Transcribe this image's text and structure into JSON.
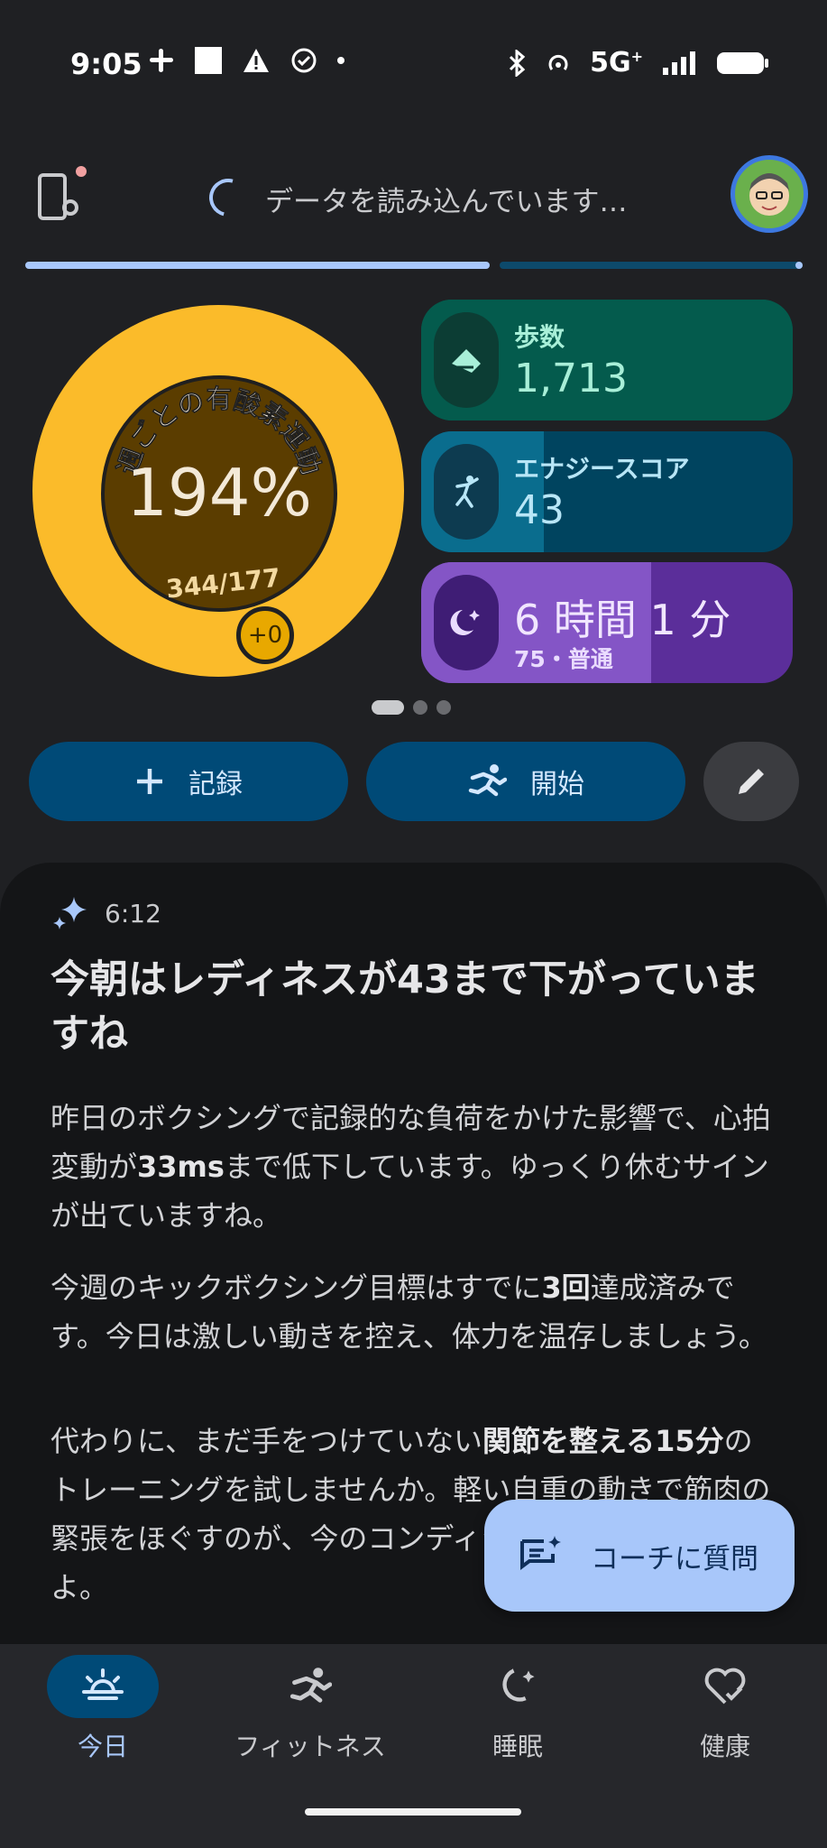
{
  "status_bar": {
    "time": "9:05",
    "network": "5G",
    "icons_left": [
      "slack-icon",
      "white-square-icon",
      "warning-icon",
      "check-circle-icon",
      "dot-icon"
    ],
    "icons_right": [
      "bluetooth-icon",
      "hotspot-icon",
      "5g-icon",
      "signal-icon",
      "battery-icon"
    ]
  },
  "header": {
    "loading_text": "データを読み込んでいます…"
  },
  "ring": {
    "label": "週ごとの有酸素運動",
    "percent": "194%",
    "ratio": "344/177",
    "badge": "+0",
    "color": "#fbbb2a"
  },
  "cards": {
    "steps": {
      "label": "歩数",
      "value": "1,713",
      "icon": "shoe-icon",
      "color": "#03584a"
    },
    "energy": {
      "label": "エナジースコア",
      "value": "43",
      "icon": "energy-person-icon",
      "fill": 0.33,
      "color": "#0a6d8e"
    },
    "sleep": {
      "value": "6 時間 1 分",
      "sub": "75・普通",
      "icon": "moon-icon",
      "fill": 0.62,
      "color": "#8455c6"
    }
  },
  "pager": {
    "count": 3,
    "active": 0
  },
  "actions": {
    "record_label": "記録",
    "start_label": "開始"
  },
  "insight": {
    "time": "6:12",
    "title": "今朝はレディネスが43まで下がっていますね",
    "p1_a": "昨日のボクシングで記録的な負荷をかけた影響で、心拍変動が",
    "p1_b": "33ms",
    "p1_c": "まで低下しています。ゆっくり休むサインが出ていますね。",
    "p2_a": "今週のキックボクシング目標はすでに",
    "p2_b": "3回",
    "p2_c": "達成済みです。今日は激しい動きを控え、体力を温存しましょう。",
    "p3_a": "代わりに、まだ手をつけていない",
    "p3_b": "関節を整える15分",
    "p3_c": "のトレーニングを試しませんか。軽い自重の動きで筋肉の緊張をほぐすのが、今のコンディションには最適ですよ。"
  },
  "fab": {
    "label": "コーチに質問"
  },
  "nav": {
    "today": "今日",
    "fitness": "フィットネス",
    "sleep": "睡眠",
    "health": "健康"
  }
}
